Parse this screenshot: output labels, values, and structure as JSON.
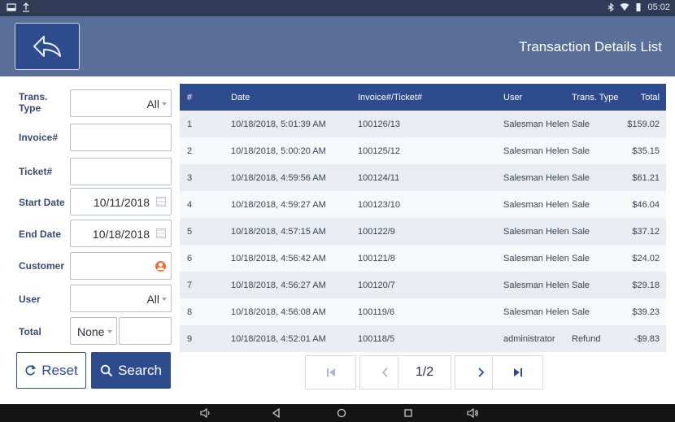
{
  "status": {
    "time": "05:02"
  },
  "header": {
    "title": "Transaction Details List"
  },
  "filters": {
    "trans_type": {
      "label": "Trans. Type",
      "value": "All"
    },
    "invoice": {
      "label": "Invoice#",
      "value": ""
    },
    "ticket": {
      "label": "Ticket#",
      "value": ""
    },
    "start_date": {
      "label": "Start Date",
      "value": "10/11/2018"
    },
    "end_date": {
      "label": "End Date",
      "value": "10/18/2018"
    },
    "customer": {
      "label": "Customer",
      "value": ""
    },
    "user": {
      "label": "User",
      "value": "All"
    },
    "total": {
      "label": "Total",
      "operator": "None",
      "value": ""
    },
    "reset_label": "Reset",
    "search_label": "Search"
  },
  "table": {
    "columns": [
      "#",
      "Date",
      "Invoice#/Ticket#",
      "User",
      "Trans. Type",
      "Total"
    ],
    "rows": [
      [
        "1",
        "10/18/2018, 5:01:39 AM",
        "100126/13",
        "Salesman Helen",
        "Sale",
        "$159.02"
      ],
      [
        "2",
        "10/18/2018, 5:00:20 AM",
        "100125/12",
        "Salesman Helen",
        "Sale",
        "$35.15"
      ],
      [
        "3",
        "10/18/2018, 4:59:56 AM",
        "100124/11",
        "Salesman Helen",
        "Sale",
        "$61.21"
      ],
      [
        "4",
        "10/18/2018, 4:59:27 AM",
        "100123/10",
        "Salesman Helen",
        "Sale",
        "$46.04"
      ],
      [
        "5",
        "10/18/2018, 4:57:15 AM",
        "100122/9",
        "Salesman Helen",
        "Sale",
        "$37.12"
      ],
      [
        "6",
        "10/18/2018, 4:56:42 AM",
        "100121/8",
        "Salesman Helen",
        "Sale",
        "$24.02"
      ],
      [
        "7",
        "10/18/2018, 4:56:27 AM",
        "100120/7",
        "Salesman Helen",
        "Sale",
        "$29.18"
      ],
      [
        "8",
        "10/18/2018, 4:56:08 AM",
        "100119/6",
        "Salesman Helen",
        "Sale",
        "$39.23"
      ],
      [
        "9",
        "10/18/2018, 4:52:01 AM",
        "100118/5",
        "administrator",
        "Refund",
        "-$9.83"
      ]
    ]
  },
  "pager": {
    "page": "1/2"
  },
  "colors": {
    "primary": "#2e4c8d",
    "header": "#5a6f98",
    "statusbar": "#2f3a55",
    "accent": "#e9723b"
  },
  "icons": [
    "back-arrow-icon",
    "reset-icon",
    "search-icon",
    "calendar-icon",
    "customer-icon",
    "first-page-icon",
    "prev-page-icon",
    "next-page-icon",
    "last-page-icon"
  ]
}
